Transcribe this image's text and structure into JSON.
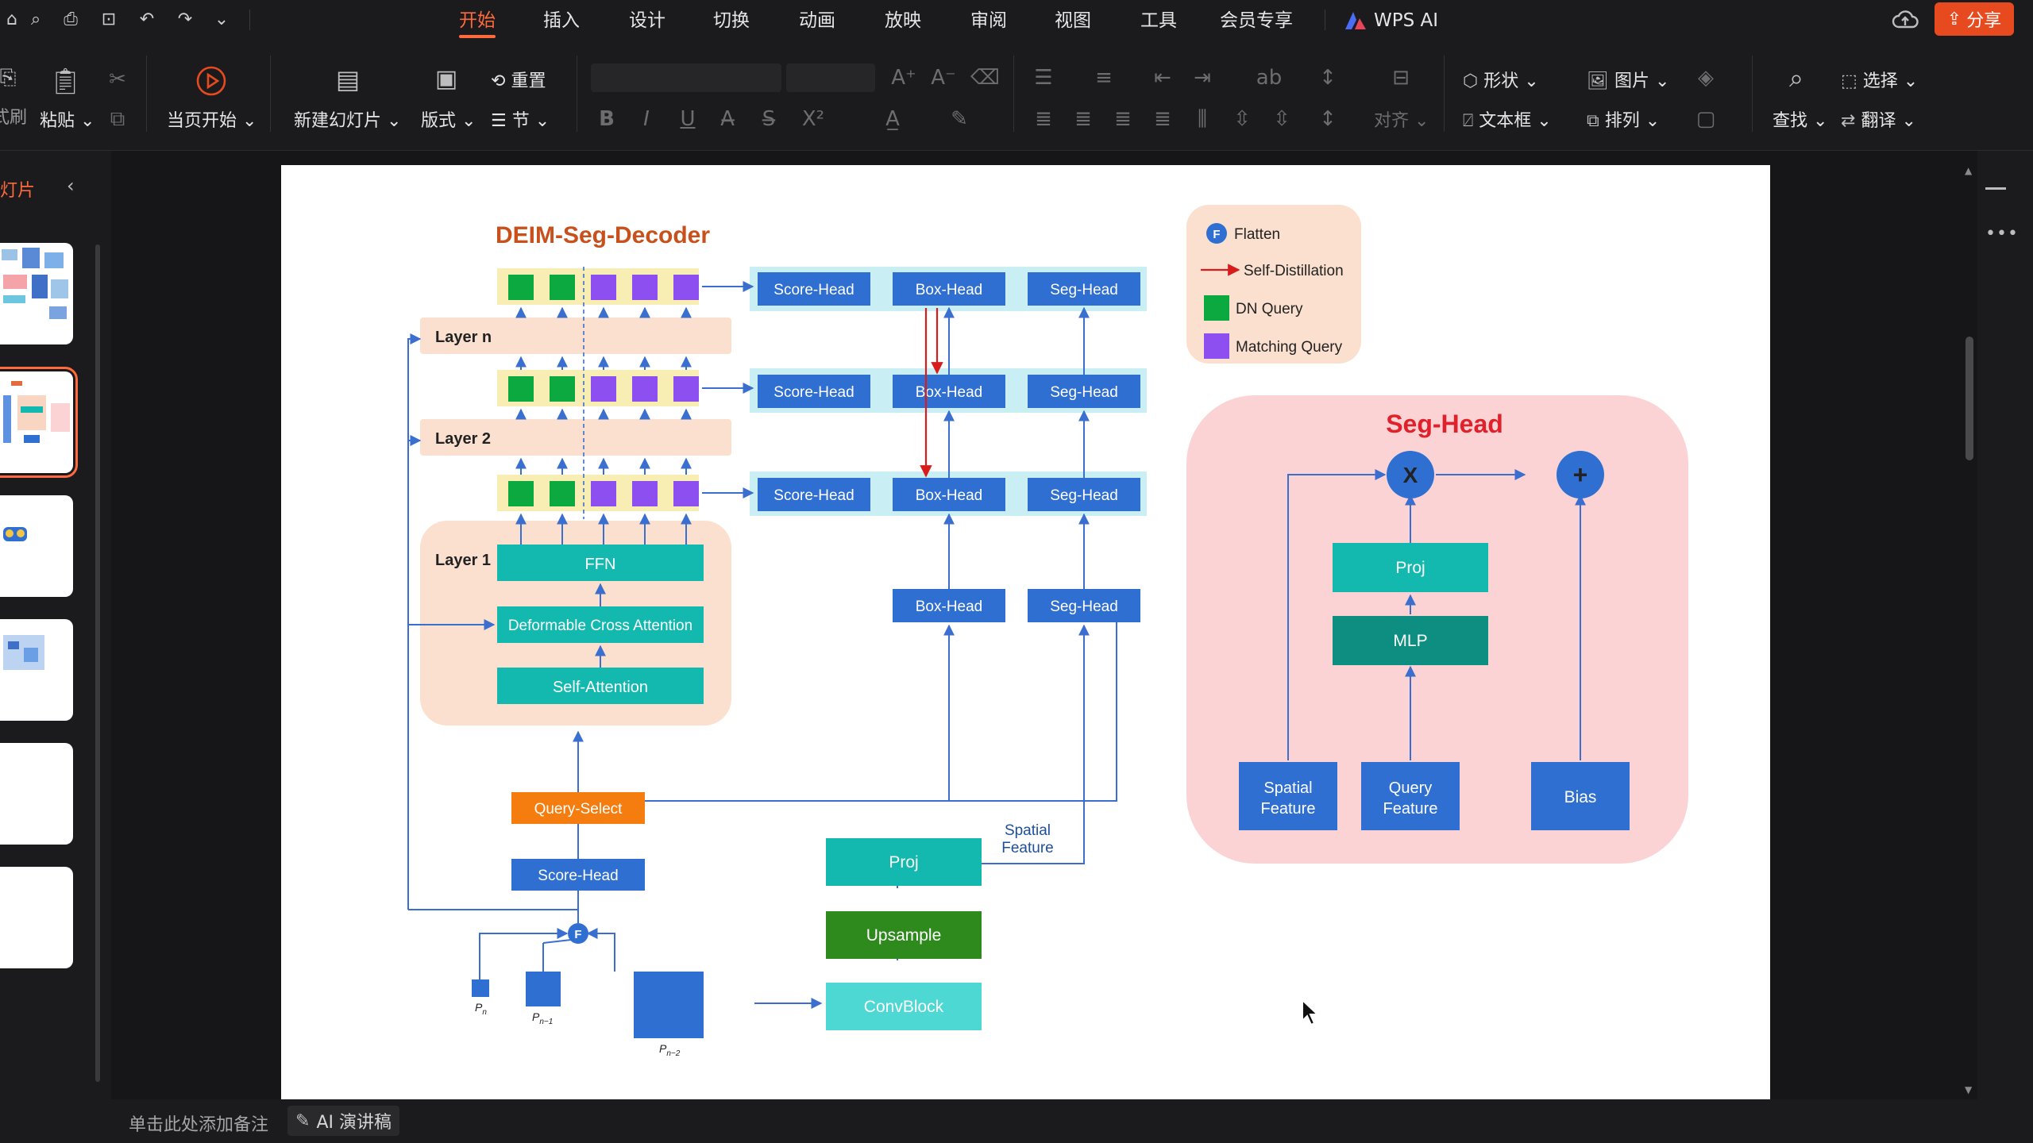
{
  "menu": {
    "tabs": [
      "开始",
      "插入",
      "设计",
      "切换",
      "动画",
      "放映",
      "审阅",
      "视图",
      "工具",
      "会员专享"
    ],
    "active_tab": "开始",
    "wps_ai": "WPS AI",
    "share": "分享"
  },
  "toolbar": {
    "paste": "粘贴",
    "format_brush": "式刷",
    "play_current": "当页开始",
    "new_slide": "新建幻灯片",
    "layout": "版式",
    "reset": "重置",
    "section": "节",
    "align": "对齐",
    "shape": "形状",
    "picture": "图片",
    "textbox": "文本框",
    "arrange": "排列",
    "find": "查找",
    "select": "选择",
    "translate": "翻译"
  },
  "left_panel": {
    "title": "灯片"
  },
  "statusbar": {
    "notes_hint": "单击此处添加备注",
    "ai_speech": "AI 演讲稿"
  },
  "diagram": {
    "title": "DEIM-Seg-Decoder",
    "layer_n": "Layer n",
    "layer_2": "Layer 2",
    "layer_1": "Layer 1",
    "ffn": "FFN",
    "deform_attn": "Deformable Cross Attention",
    "self_attn": "Self-Attention",
    "query_select": "Query-Select",
    "score_head": "Score-Head",
    "box_head": "Box-Head",
    "seg_head": "Seg-Head",
    "proj": "Proj",
    "upsample": "Upsample",
    "convblock": "ConvBlock",
    "spatial_feature_1": "Spatial",
    "spatial_feature_2": "Feature",
    "flatten_symbol": "F",
    "p_n": "P",
    "p_n_sub": "n",
    "p_n1_sub": "n−1",
    "p_n2_sub": "n−2",
    "legend": {
      "flatten": "Flatten",
      "self_distillation": "Self-Distillation",
      "dn_query": "DN Query",
      "matching_query": "Matching Query"
    },
    "seghead_panel": {
      "title": "Seg-Head",
      "multiply": "X",
      "plus": "+",
      "proj": "Proj",
      "mlp": "MLP",
      "spatial_1": "Spatial",
      "spatial_2": "Feature",
      "query_1": "Query",
      "query_2": "Feature",
      "bias": "Bias"
    }
  },
  "colors": {
    "accent": "#ff6a3d",
    "teal": "#13b8ae",
    "blue": "#2f6fd1",
    "green": "#0ca840",
    "purple": "#8e4ff0",
    "orange": "#f57c0f",
    "peach": "#fbe0cf",
    "pink": "#fbd3d5",
    "lightcyan": "#c9eef3",
    "red": "#d81b1b"
  }
}
